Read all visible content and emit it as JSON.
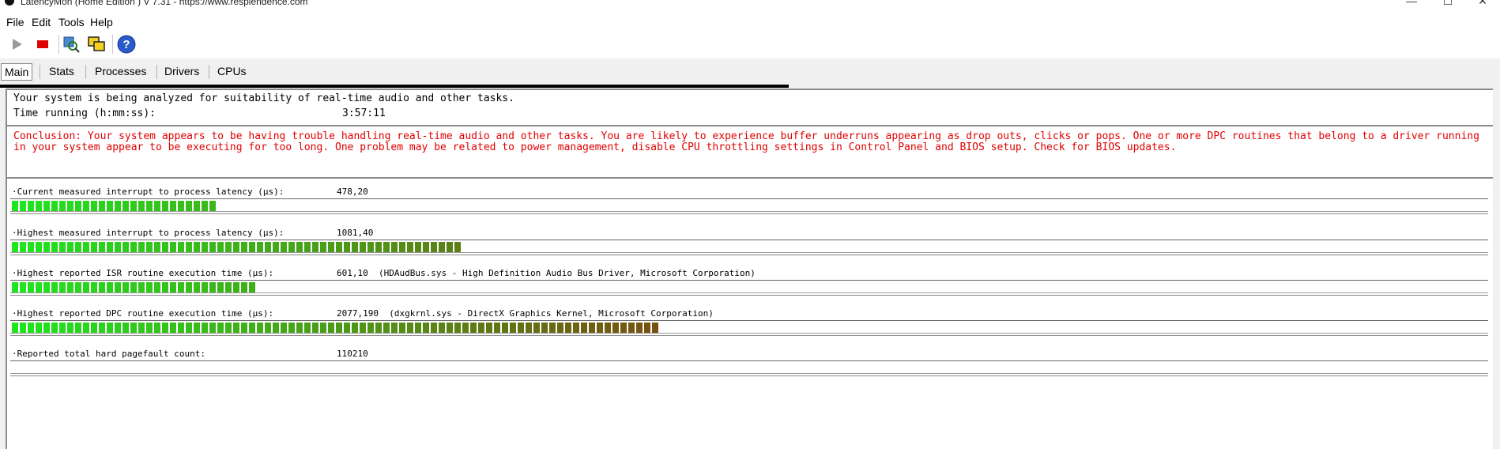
{
  "window": {
    "title": "LatencyMon  (Home Edition )  V 7.31 - https://www.resplendence.com",
    "controls": [
      "—",
      "☐",
      "✕"
    ]
  },
  "menu": [
    "File",
    "Edit",
    "Tools",
    "Help"
  ],
  "toolbar": {
    "icons": [
      "play-icon",
      "stop-icon",
      "inspect-icon",
      "windows-icon",
      "help-icon"
    ]
  },
  "tabs": [
    "Main",
    "Stats",
    "Processes",
    "Drivers",
    "CPUs"
  ],
  "intro": {
    "analyzing": "Your system is being analyzed for suitability of real-time audio and other tasks.",
    "time_label": "Time running (h:mm:ss):",
    "time_value": "3:57:11"
  },
  "conclusion": "Conclusion: Your system appears to be having trouble handling real-time audio and other tasks. You are likely to experience buffer underruns appearing as drop outs, clicks or pops. One or more DPC routines that belong to a driver running in your system appear to be executing for too long. One problem may be related to power management, disable CPU throttling settings in Control Panel and BIOS setup. Check for BIOS updates.",
  "metrics": [
    {
      "label": "·Current measured interrupt to process latency (µs):",
      "value": "478,20",
      "detail": "",
      "level": 0.14
    },
    {
      "label": "·Highest measured interrupt to process latency (µs):",
      "value": "1081,40",
      "detail": "",
      "level": 0.31
    },
    {
      "label": "·Highest reported ISR routine execution time (µs):",
      "value": "601,10",
      "detail": "(HDAudBus.sys - High Definition Audio Bus Driver, Microsoft Corporation)",
      "level": 0.17
    },
    {
      "label": "·Highest reported DPC routine execution time (µs):",
      "value": "2077,190",
      "detail": "(dxgkrnl.sys - DirectX Graphics Kernel, Microsoft Corporation)",
      "level": 0.44
    },
    {
      "label": "·Reported total hard pagefault count:",
      "value": "110210",
      "detail": "",
      "level": 0
    }
  ],
  "colors": {
    "good": "#1ee61e",
    "warn": "#7a5a10",
    "conclusion": "#e00000"
  }
}
